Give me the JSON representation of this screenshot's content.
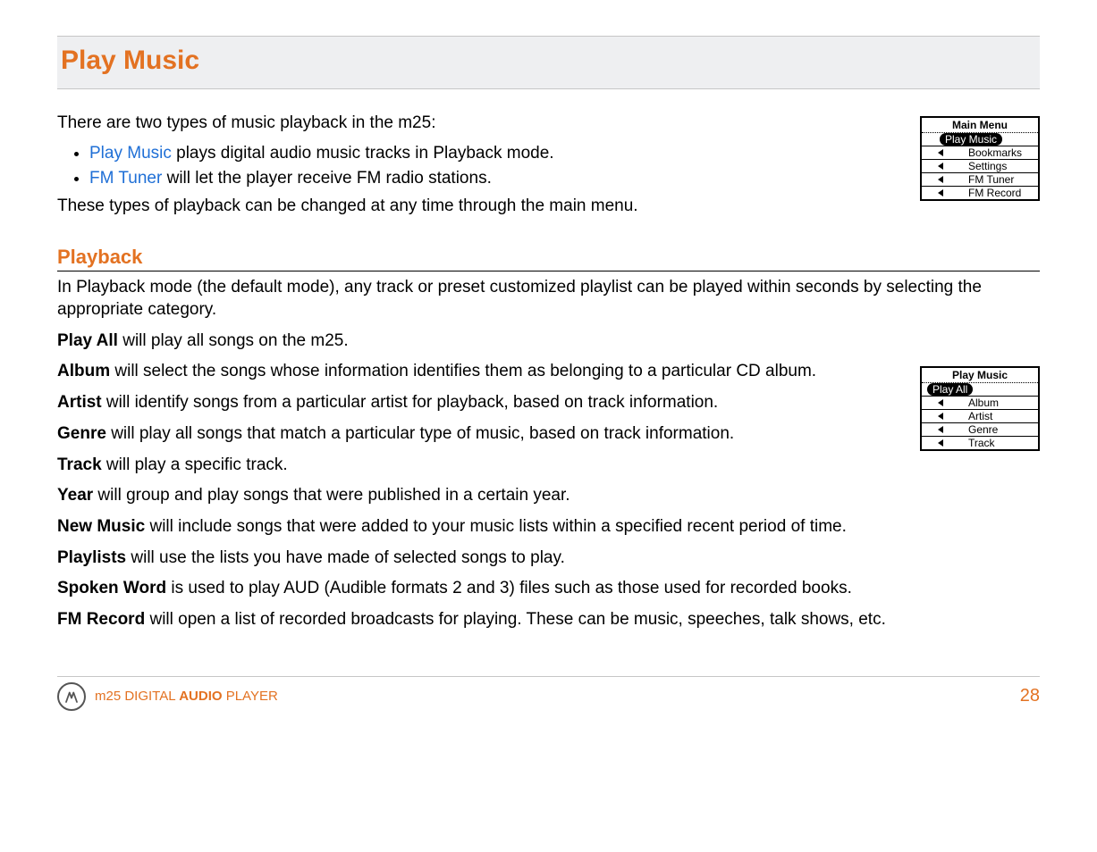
{
  "title": "Play Music",
  "intro": "There are two types of music playback in the m25:",
  "bullets": [
    {
      "link": "Play Music",
      "rest": " plays digital audio music tracks in Playback mode."
    },
    {
      "link": "FM Tuner",
      "rest": " will let the player receive FM radio stations."
    }
  ],
  "intro2": "These types of playback can be changed at any time through the main menu.",
  "main_menu_screenshot": {
    "header": "Main Menu",
    "items": [
      {
        "label": "Play Music",
        "selected": true
      },
      {
        "label": "Bookmarks",
        "selected": false
      },
      {
        "label": "Settings",
        "selected": false
      },
      {
        "label": "FM Tuner",
        "selected": false
      },
      {
        "label": "FM Record",
        "selected": false
      }
    ]
  },
  "subheading": "Playback",
  "playback_intro": "In Playback mode (the default mode), any track or preset customized playlist can be played within seconds by selecting the appropriate category.",
  "defs": [
    {
      "term": "Play All",
      "rest": " will play all songs on the m25."
    },
    {
      "term": "Album",
      "rest": " will select the songs whose information identifies them as belonging to a particular CD album."
    },
    {
      "term": "Artist",
      "rest": " will identify songs from a particular artist for playback, based on track information."
    },
    {
      "term": "Genre",
      "rest": " will play all songs that match a particular type of music, based on track information."
    },
    {
      "term": "Track",
      "rest": " will play a specific track."
    },
    {
      "term": "Year",
      "rest": " will group and play songs that were published in a certain year."
    },
    {
      "term": "New Music",
      "rest": " will include songs that were added to your music lists within a specified recent period of time."
    },
    {
      "term": "Playlists",
      "rest": " will use the lists you have made of selected songs to play."
    },
    {
      "term": "Spoken Word",
      "rest": " is used to play AUD (Audible formats 2 and 3) files such as those used for recorded books."
    },
    {
      "term": "FM Record",
      "rest": " will open a list of recorded broadcasts for playing. These can be music, speeches, talk shows, etc."
    }
  ],
  "play_music_screenshot": {
    "header": "Play Music",
    "items": [
      {
        "label": "Play All",
        "selected": true
      },
      {
        "label": "Album",
        "selected": false
      },
      {
        "label": "Artist",
        "selected": false
      },
      {
        "label": "Genre",
        "selected": false
      },
      {
        "label": "Track",
        "selected": false
      }
    ]
  },
  "footer": {
    "brand_prefix": "m25 DIGITAL ",
    "brand_bold": "AUDIO",
    "brand_suffix": " PLAYER",
    "page": "28"
  }
}
